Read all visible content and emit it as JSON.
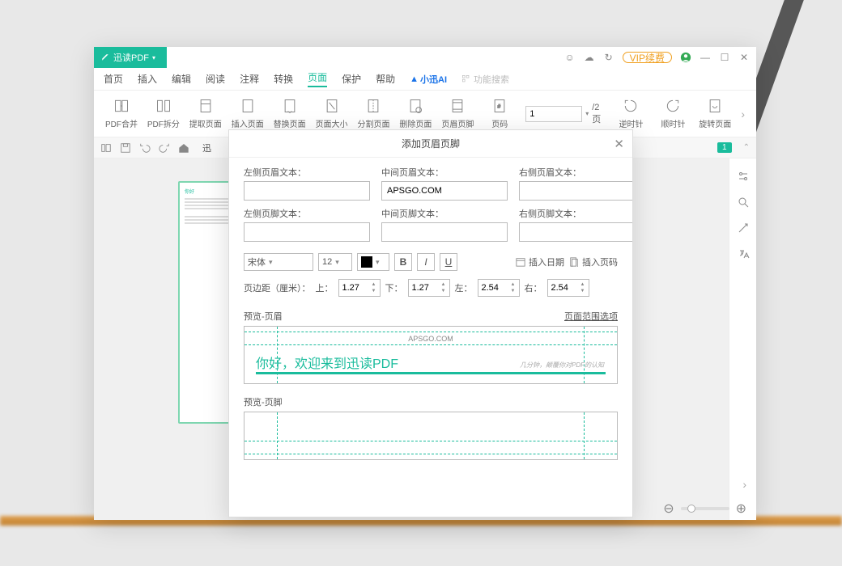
{
  "app": {
    "name": "迅读PDF"
  },
  "titlebar": {
    "vip": "VIP续费"
  },
  "menu": [
    "首页",
    "插入",
    "编辑",
    "阅读",
    "注释",
    "转换",
    "页面",
    "保护",
    "帮助"
  ],
  "menu_active_index": 6,
  "ai_label": "小迅AI",
  "search_placeholder": "功能搜索",
  "ribbon": [
    {
      "id": "merge",
      "label": "PDF合并"
    },
    {
      "id": "split",
      "label": "PDF拆分"
    },
    {
      "id": "extract",
      "label": "提取页面"
    },
    {
      "id": "insert",
      "label": "插入页面"
    },
    {
      "id": "replace",
      "label": "替换页面"
    },
    {
      "id": "size",
      "label": "页面大小"
    },
    {
      "id": "splitpg",
      "label": "分割页面"
    },
    {
      "id": "delete",
      "label": "删除页面"
    },
    {
      "id": "headerfooter",
      "label": "页眉页脚"
    },
    {
      "id": "pagenum",
      "label": "页码"
    }
  ],
  "pager": {
    "current": "1",
    "total_label": "/2页"
  },
  "rotate": [
    {
      "id": "ccw",
      "label": "逆时针"
    },
    {
      "id": "cw",
      "label": "顺时针"
    },
    {
      "id": "rotpg",
      "label": "旋转页面"
    }
  ],
  "doc_tab": "迅",
  "badge": "1",
  "modal": {
    "title": "添加页眉页脚",
    "labels": {
      "hl": "左侧页眉文本：",
      "hc": "中间页眉文本：",
      "hr": "右侧页眉文本：",
      "fl": "左侧页脚文本：",
      "fc": "中间页脚文本：",
      "fr": "右侧页脚文本："
    },
    "values": {
      "hl": "",
      "hc": "APSGO.COM",
      "hr": "",
      "fl": "",
      "fc": "",
      "fr": ""
    },
    "font_name": "宋体",
    "font_size": "12",
    "insert_date": "插入日期",
    "insert_page": "插入页码",
    "margin_label": "页边距（厘米）：",
    "margin": {
      "top_l": "上：",
      "top": "1.27",
      "bottom_l": "下：",
      "bottom": "1.27",
      "left_l": "左：",
      "left": "2.54",
      "right_l": "右：",
      "right": "2.54"
    },
    "preview_header": "预览-页眉",
    "preview_footer": "预览-页脚",
    "range_opts": "页面范围选项",
    "pv_text_small": "APSGO.COM",
    "pv_text_big": "你好，欢迎来到迅读PDF",
    "pv_text_sub": "几分钟，颠覆你对PDF的认知"
  }
}
